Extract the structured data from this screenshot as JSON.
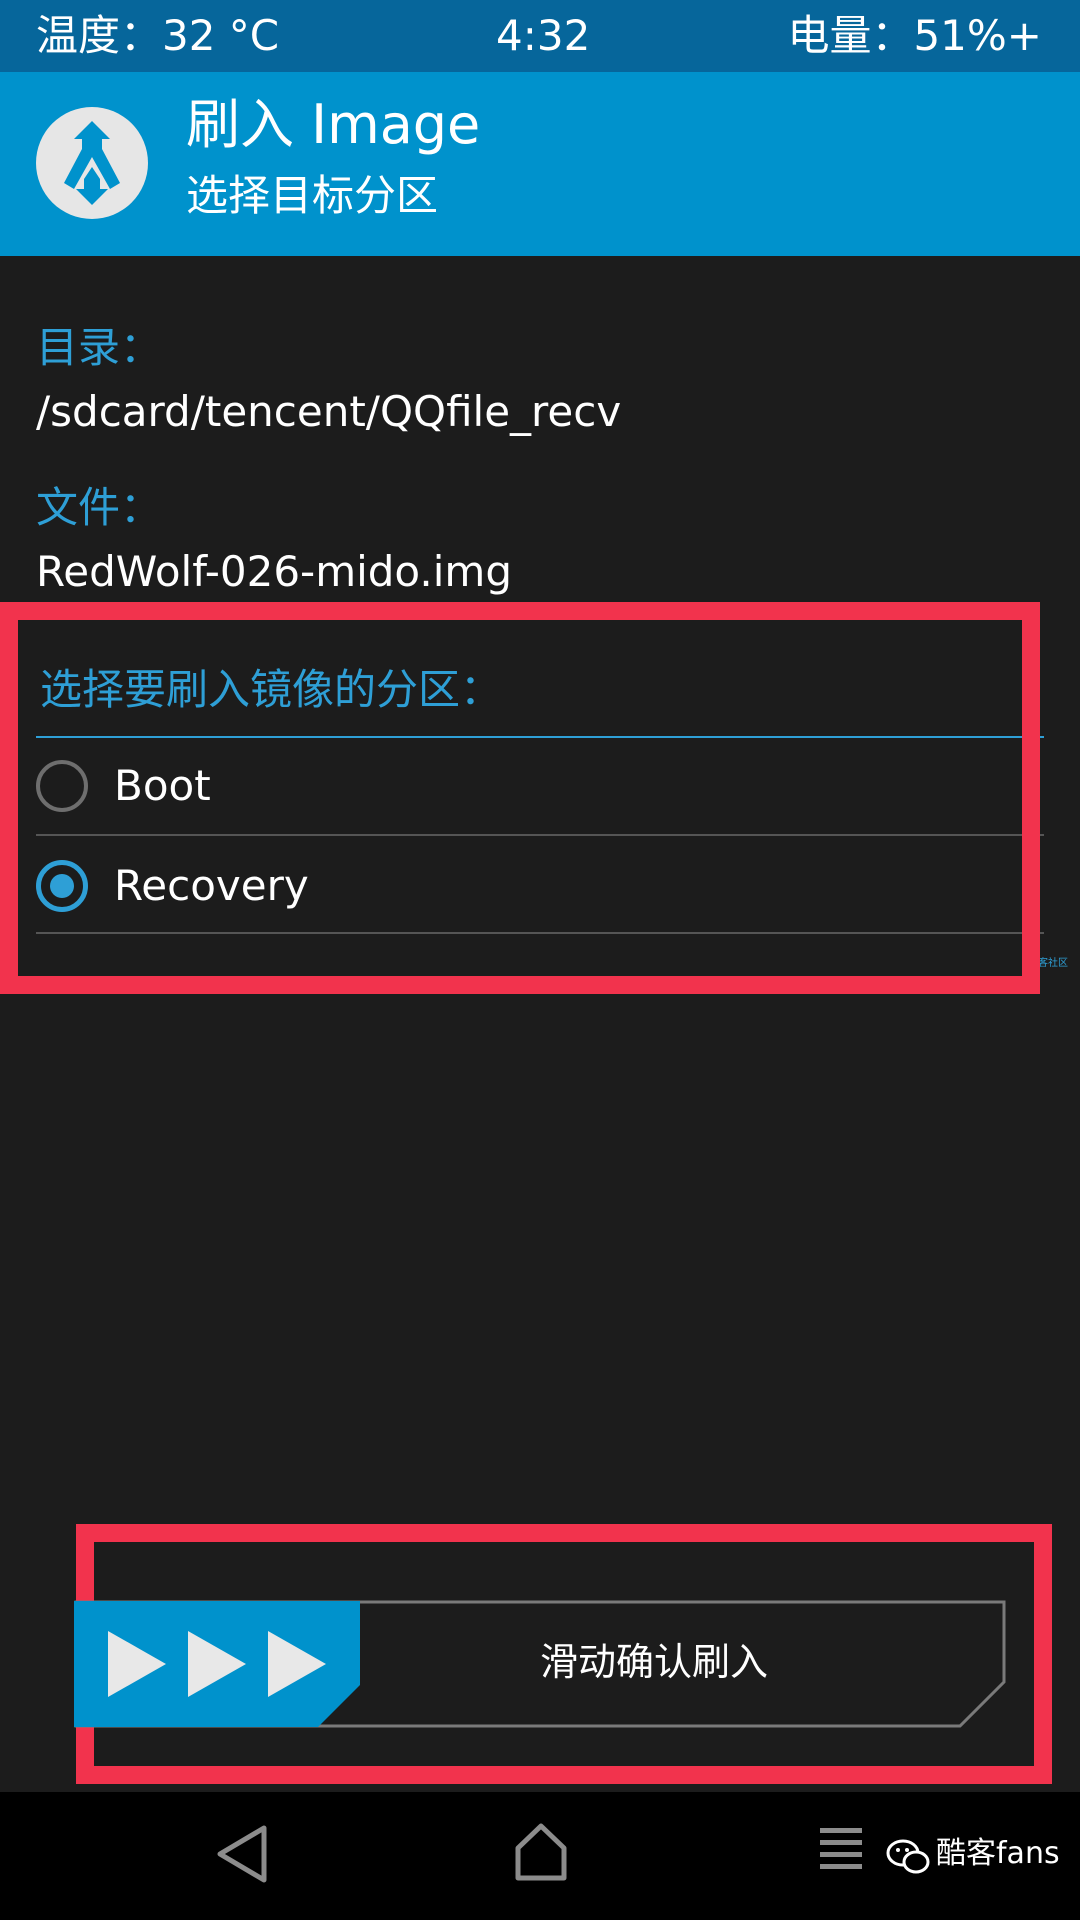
{
  "status_bar": {
    "temperature": "温度：32 °C",
    "time": "4:32",
    "battery": "电量：51%+",
    "bg_color": "#06669b"
  },
  "header": {
    "title": "刷入 Image",
    "subtitle": "选择目标分区",
    "logo_icon": "twrp-logo-icon",
    "bg_color": "#0092cc"
  },
  "content": {
    "directory_label": "目录：",
    "directory_value": "/sdcard/tencent/QQfile_recv",
    "file_label": "文件：",
    "file_value": "RedWolf-026-mido.img",
    "partition_prompt": "选择要刷入镜像的分区：",
    "partitions": [
      {
        "label": "Boot",
        "selected": false
      },
      {
        "label": "Recovery",
        "selected": true
      }
    ],
    "side_watermark": "酷客社区"
  },
  "slider": {
    "label": "滑动确认刷入",
    "handle_icon": "triple-play-arrow-icon",
    "accent_color": "#0092cc"
  },
  "nav_bar": {
    "back_icon": "back-triangle-icon",
    "home_icon": "home-icon",
    "menu_icon": "menu-lines-icon"
  },
  "watermark": {
    "text": "酷客fans",
    "icon": "wechat-icon"
  },
  "colors": {
    "background": "#1c1c1c",
    "accent_blue": "#2e9fd6",
    "highlight_red": "#f2334d"
  }
}
